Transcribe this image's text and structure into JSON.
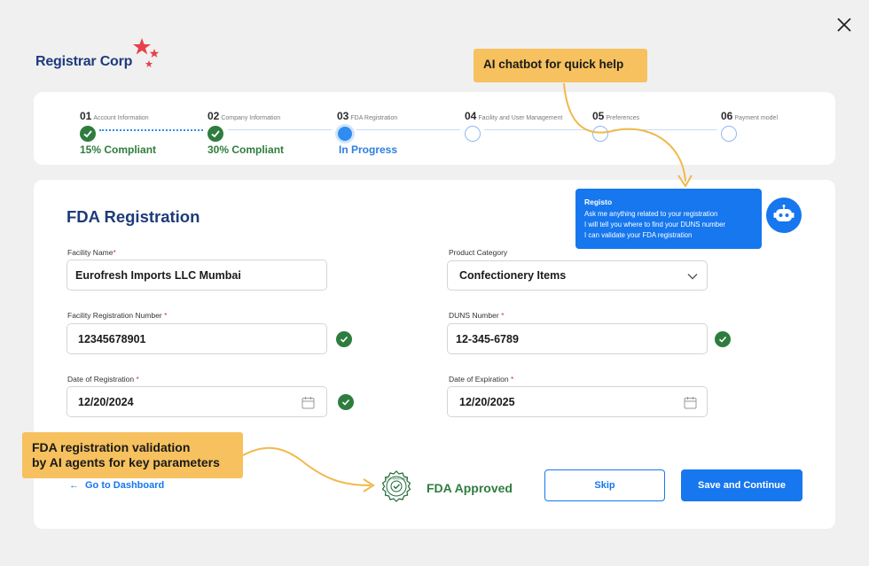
{
  "brand": {
    "name": "Registrar Corp",
    "star_color": "#e8404b",
    "text_color": "#1d3b7a"
  },
  "stepper": {
    "steps": [
      {
        "num": "01",
        "label": "Account Information",
        "status": "15% Compliant",
        "state": "done"
      },
      {
        "num": "02",
        "label": "Company Information",
        "status": "30% Compliant",
        "state": "done"
      },
      {
        "num": "03",
        "label": "FDA Registration",
        "status": "In Progress",
        "state": "current"
      },
      {
        "num": "04",
        "label": "Facility and User Management",
        "status": "",
        "state": "pending"
      },
      {
        "num": "05",
        "label": "Preferences",
        "status": "",
        "state": "pending"
      },
      {
        "num": "06",
        "label": "Payment model",
        "status": "",
        "state": "pending"
      }
    ]
  },
  "annotations": {
    "chatbot": "AI chatbot for quick help",
    "validation": "FDA registration validation\nby AI agents for key parameters"
  },
  "form": {
    "title": "FDA Registration",
    "facility_name": {
      "label": "Facility Name",
      "value": "Eurofresh Imports LLC Mumbai"
    },
    "product_category": {
      "label": "Product Category",
      "value": "Confectionery Items"
    },
    "facility_reg_number": {
      "label": "Facility Registration Number",
      "value": "12345678901"
    },
    "duns_number": {
      "label": "DUNS Number",
      "value": "12-345-6789"
    },
    "date_registration": {
      "label": "Date of Registration",
      "value": "12/20/2024"
    },
    "date_expiration": {
      "label": "Date of Expiration",
      "value": "12/20/2025"
    },
    "required_mark": "*"
  },
  "chatbot": {
    "name": "Registo",
    "lines": [
      "Ask me anything related to your registration",
      "I will tell you where to find your DUNS number",
      "I can validate your FDA registration"
    ]
  },
  "actions": {
    "back": "Go to Dashboard",
    "approved": "FDA Approved",
    "seal_text": "FDA APPROVED",
    "skip": "Skip",
    "save": "Save and Continue"
  },
  "colors": {
    "primary": "#1677ee",
    "success": "#2e7d3e",
    "annotation": "#f6c15e",
    "navy": "#1d3b7a"
  },
  "icons": {
    "close": "close-icon",
    "check": "check-icon",
    "calendar": "calendar-icon",
    "chevron": "chevron-down-icon",
    "bot": "robot-icon",
    "arrow_left": "arrow-left-icon",
    "seal": "approved-seal-icon"
  }
}
